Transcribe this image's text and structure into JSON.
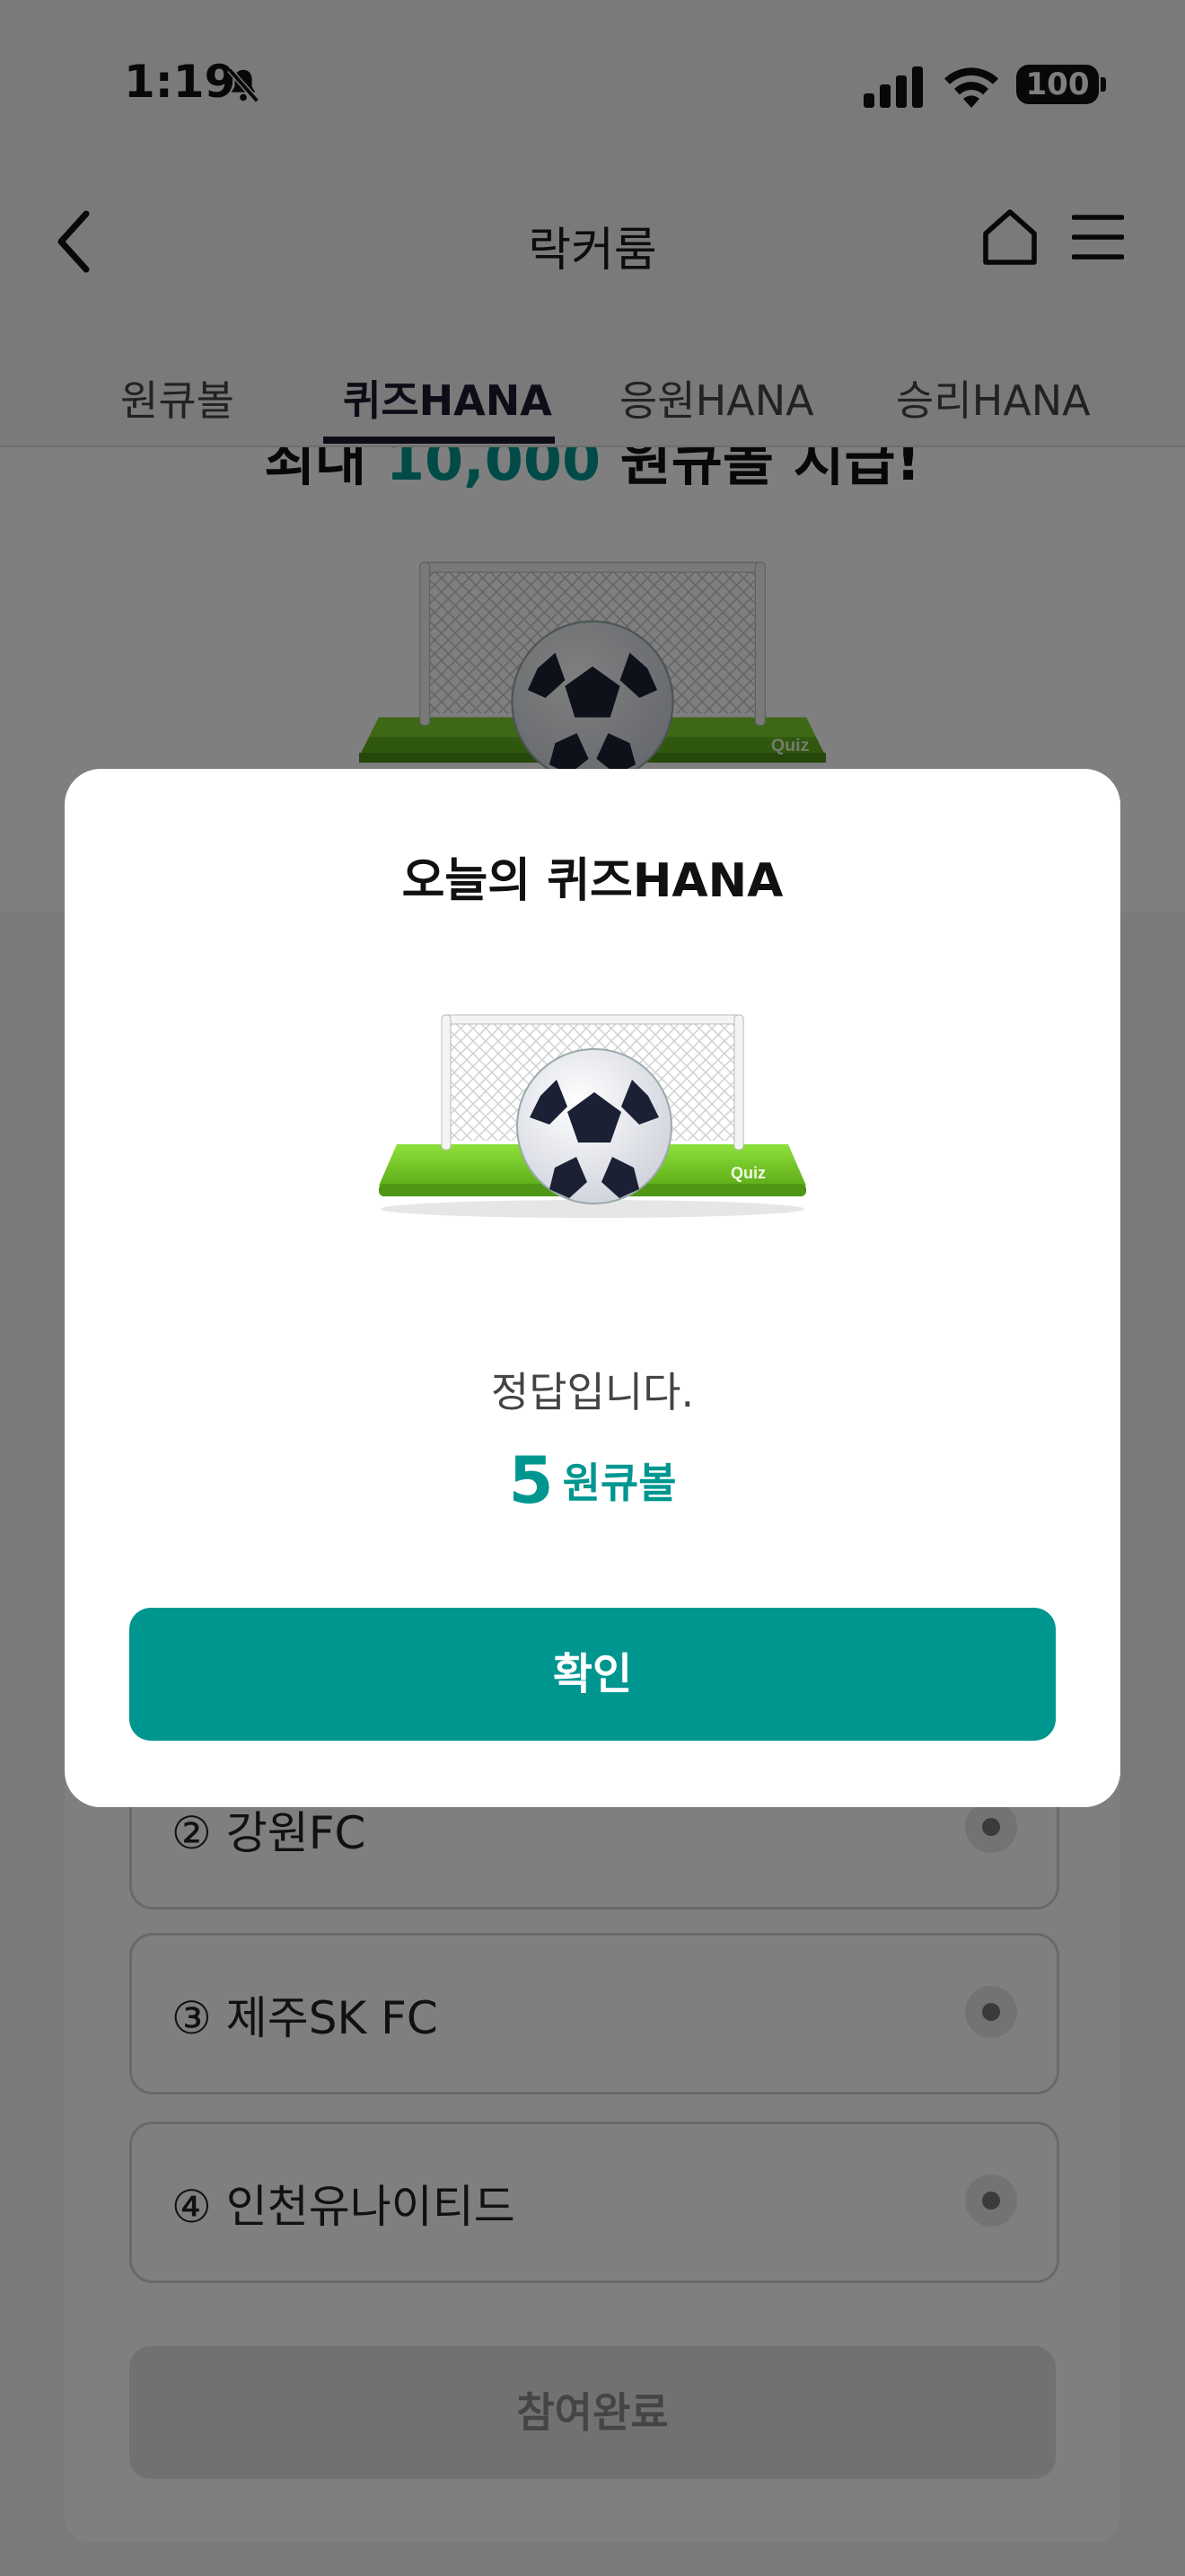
{
  "status_bar": {
    "time": "1:19",
    "battery": "100"
  },
  "nav": {
    "title": "락커룸",
    "tabs": [
      "원큐볼",
      "퀴즈HANA",
      "응원HANA",
      "승리HANA"
    ]
  },
  "promo": {
    "prefix": "최대",
    "amount": "10,000",
    "suffix": "원큐볼 지급!"
  },
  "options": [
    "② 강원FC",
    "③ 제주SK FC",
    "④ 인천유나이티드"
  ],
  "done_button": "참여완료",
  "modal": {
    "title": "오늘의 퀴즈HANA",
    "image_label": "Quiz",
    "message": "정답입니다.",
    "reward_amount": "5",
    "reward_unit": "원큐볼",
    "confirm_label": "확인"
  },
  "colors": {
    "accent": "#009690",
    "goal_green": "#6cbd1e"
  }
}
